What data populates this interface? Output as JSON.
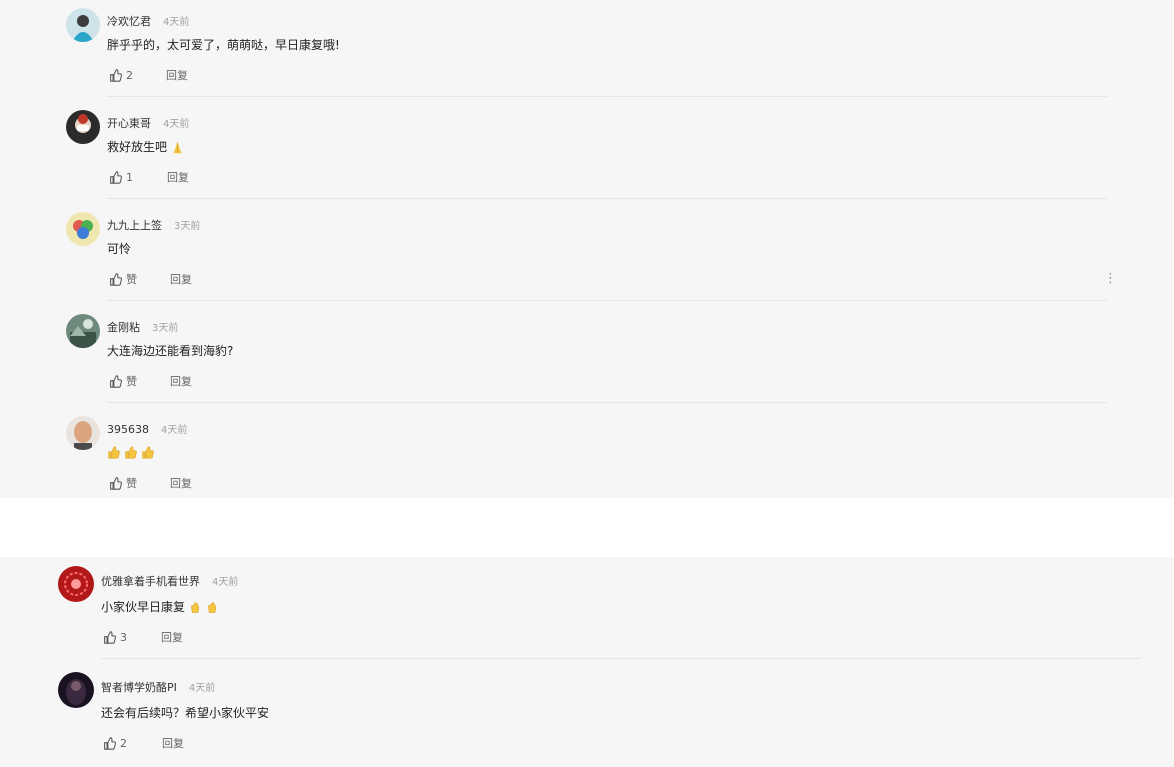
{
  "comments_top": [
    {
      "username": "冷欢忆君",
      "time": "4天前",
      "content": "胖乎乎的，太可爱了，萌萌哒，早日康复哦!",
      "likes": "2",
      "reply": "回复"
    },
    {
      "username": "开心東哥",
      "time": "4天前",
      "content": "救好放生吧",
      "likes": "1",
      "reply": "回复"
    },
    {
      "username": "九九上上签",
      "time": "3天前",
      "content": "可怜",
      "likes": "赞",
      "reply": "回复"
    },
    {
      "username": "金刚粘",
      "time": "3天前",
      "content": "大连海边还能看到海豹?",
      "likes": "赞",
      "reply": "回复"
    },
    {
      "username": "395638",
      "time": "4天前",
      "content": "",
      "likes": "赞",
      "reply": "回复"
    }
  ],
  "comments_bottom": [
    {
      "username": "优雅拿着手机看世界",
      "time": "4天前",
      "content": "小家伙早日康复",
      "likes": "3",
      "reply": "回复"
    },
    {
      "username": "智者博学奶酪PI",
      "time": "4天前",
      "content": "还会有后续吗？希望小家伙平安",
      "likes": "2",
      "reply": "回复"
    }
  ],
  "more_label": "⋮",
  "icons": [
    "thumbs-up-icon",
    "more-icon",
    "pray-emoji-icon",
    "thumbs-up-emoji-icon",
    "clap-emoji-icon"
  ]
}
